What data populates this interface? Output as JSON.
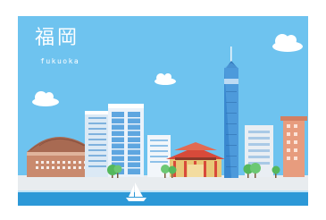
{
  "illustration": {
    "title": "福岡",
    "subtitle": "fukuoka"
  },
  "colors": {
    "sky": "#6ec3ef",
    "ground": "#e8ecef",
    "water": "#2c98d7",
    "dome": "#c98a6e",
    "tower": "#3a88cf",
    "temple": "#d84a3a",
    "tree": "#55b85c"
  }
}
